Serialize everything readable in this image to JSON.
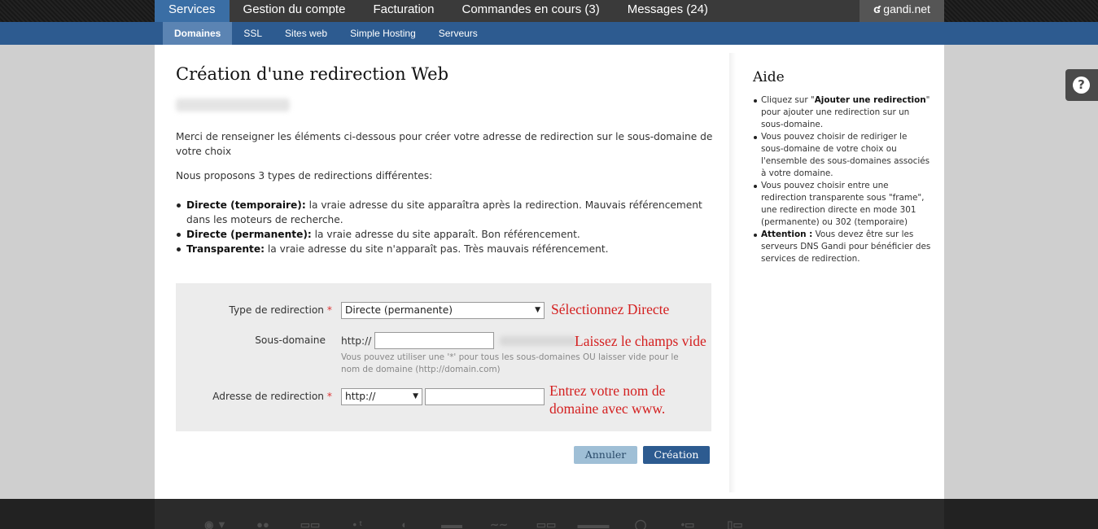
{
  "topnav": {
    "tabs": [
      "Services",
      "Gestion du compte",
      "Facturation",
      "Commandes en cours (3)",
      "Messages (24)"
    ],
    "brand": "gandi.net",
    "brand_icon": "gandi-g-icon"
  },
  "subnav": {
    "tabs": [
      "Domaines",
      "SSL",
      "Sites web",
      "Simple Hosting",
      "Serveurs"
    ]
  },
  "main": {
    "title": "Création d'une redirection Web",
    "intro": "Merci de renseigner les éléments ci-dessous pour créer votre adresse de redirection sur le sous-domaine de votre choix",
    "types_intro": "Nous proposons 3 types de redirections différentes:",
    "types": [
      {
        "term": "Directe (temporaire):",
        "text": " la vraie adresse du site apparaîtra après la redirection. Mauvais référencement dans les moteurs de recherche."
      },
      {
        "term": "Directe (permanente):",
        "text": " la vraie adresse du site apparaît. Bon référencement."
      },
      {
        "term": "Transparente:",
        "text": " la vraie adresse du site n'apparaît pas. Très mauvais référencement."
      }
    ]
  },
  "form": {
    "type_label": "Type de redirection",
    "type_value": "Directe (permanente)",
    "subdomain_label": "Sous-domaine",
    "subdomain_prefix": "http://",
    "subdomain_value": "",
    "subdomain_hint": "Vous pouvez utiliser une '*' pour tous les sous-domaines OU laisser vide pour le nom de domaine (http://domain.com)",
    "target_label": "Adresse de redirection",
    "target_protocol": "http://",
    "target_value": "",
    "required_mark": "*",
    "note_type": "Sélectionnez Directe",
    "note_subdomain": "Laissez le champs vide",
    "note_target_1": "Entrez votre nom de",
    "note_target_2": "domaine avec www.",
    "cancel": "Annuler",
    "create": "Création"
  },
  "aside": {
    "title": "Aide",
    "items": [
      {
        "pre": "Cliquez sur \"",
        "bold": "Ajouter une redirection",
        "post": "\" pour ajouter une redirection sur un sous-domaine."
      },
      {
        "pre": "Vous pouvez choisir de rediriger le sous-domaine de votre choix ou l'ensemble des sous-domaines associés à votre domaine.",
        "bold": "",
        "post": ""
      },
      {
        "pre": "Vous pouvez choisir entre une redirection transparente sous \"frame\", une redirection directe en mode 301 (permanente) ou 302 (temporaire)",
        "bold": "",
        "post": ""
      },
      {
        "pre": "",
        "bold": "Attention :",
        "post": " Vous devez être sur les serveurs DNS Gandi pour bénéficier des services de redirection."
      }
    ]
  },
  "help": {
    "label": "?"
  },
  "footer": {
    "logos": [
      "verisign-logo-icon",
      "org-logo-icon",
      "info-logo-icon",
      "tv-logo-icon",
      "me-logo-icon",
      "eurid-logo-icon",
      "afnic-logo-icon",
      "dnsbe-logo-icon",
      "switch-logo-icon",
      "biz-logo-icon",
      "pro-logo-icon",
      "ldns-logo-icon"
    ]
  }
}
